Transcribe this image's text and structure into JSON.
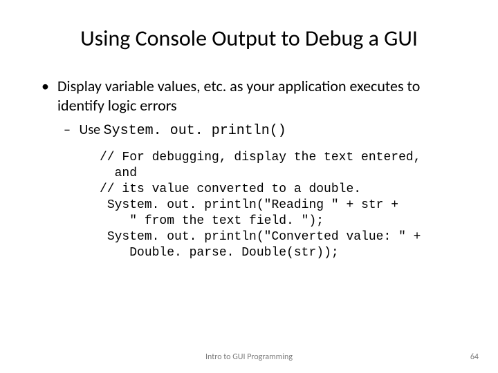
{
  "title": "Using Console Output to Debug a GUI",
  "bullet1": "Display variable values, etc. as your application executes to identify logic errors",
  "bullet2_prefix": "Use ",
  "bullet2_code": "System. out. println()",
  "code": "// For debugging, display the text entered,\n  and\n// its value converted to a double.\n System. out. println(\"Reading \" + str +\n    \" from the text field. \");\n System. out. println(\"Converted value: \" +\n    Double. parse. Double(str));",
  "footer_center": "Intro to GUI Programming",
  "footer_right": "64"
}
